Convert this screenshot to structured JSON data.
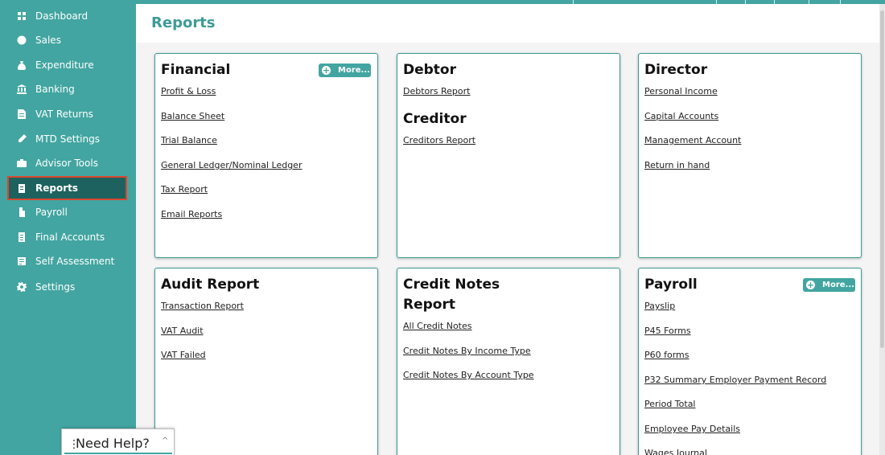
{
  "sidebar": {
    "items": [
      {
        "label": "Dashboard",
        "icon": "dashboard-icon"
      },
      {
        "label": "Sales",
        "icon": "sales-icon"
      },
      {
        "label": "Expenditure",
        "icon": "expenditure-icon"
      },
      {
        "label": "Banking",
        "icon": "bank-icon"
      },
      {
        "label": "VAT Returns",
        "icon": "vat-icon"
      },
      {
        "label": "MTD Settings",
        "icon": "mtd-icon"
      },
      {
        "label": "Advisor Tools",
        "icon": "briefcase-icon"
      },
      {
        "label": "Reports",
        "icon": "reports-icon",
        "active": true
      },
      {
        "label": "Payroll",
        "icon": "payroll-icon"
      },
      {
        "label": "Final Accounts",
        "icon": "document-icon"
      },
      {
        "label": "Self Assessment",
        "icon": "assessment-icon"
      },
      {
        "label": "Settings",
        "icon": "gear-icon"
      }
    ]
  },
  "header": {
    "title": "Reports"
  },
  "cards": {
    "financial": {
      "title": "Financial",
      "more": "More...",
      "links": [
        "Profit & Loss",
        "Balance Sheet",
        "Trial Balance",
        "General Ledger/Nominal Ledger",
        "Tax Report",
        "Email Reports"
      ]
    },
    "debtor": {
      "title": "Debtor",
      "links": [
        "Debtors Report"
      ],
      "subtitle": "Creditor",
      "sublinks": [
        "Creditors Report"
      ]
    },
    "director": {
      "title": "Director",
      "links": [
        "Personal Income",
        "Capital Accounts",
        "Management Account",
        "Return in hand"
      ]
    },
    "audit": {
      "title": "Audit Report",
      "links": [
        "Transaction Report",
        "VAT Audit",
        "VAT Failed"
      ]
    },
    "credit_notes": {
      "title_line1": "Credit Notes",
      "title_line2": "Report",
      "links": [
        "All Credit Notes",
        "Credit Notes By Income Type",
        "Credit Notes By Account Type"
      ]
    },
    "payroll": {
      "title": "Payroll",
      "more": "More...",
      "links": [
        "Payslip",
        "P45 Forms",
        "P60 forms",
        "P32 Summary Employer Payment Record",
        "Period Total",
        "Employee Pay Details",
        "Wages Journal"
      ]
    }
  },
  "help_widget": {
    "label": "Need Help?",
    "dots": "⋮",
    "chevron": "^"
  },
  "colors": {
    "sidebar": "#42a5a1",
    "active_item": "#1d625f",
    "active_border": "#d9472f",
    "title": "#3d9b98"
  }
}
